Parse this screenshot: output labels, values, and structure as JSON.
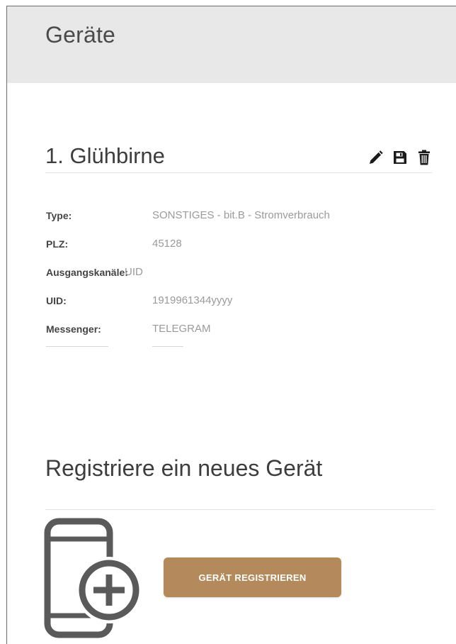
{
  "page": {
    "title": "Geräte"
  },
  "device": {
    "index_title": "1. Glühbirne",
    "actions": [
      {
        "name": "edit",
        "icon": "pencil-icon"
      },
      {
        "name": "save",
        "icon": "floppy-disk-icon"
      },
      {
        "name": "delete",
        "icon": "trash-icon"
      }
    ],
    "details": [
      {
        "label": "Type:",
        "value": "SONSTIGES - bit.B - Stromverbrauch"
      },
      {
        "label": "PLZ:",
        "value": "45128"
      },
      {
        "label": "Ausgangskanäle:",
        "value": "UID"
      },
      {
        "label": "UID:",
        "value": "1919961344yyyy"
      },
      {
        "label": "Messenger:",
        "value": "TELEGRAM"
      }
    ]
  },
  "register": {
    "heading": "Registriere ein neues Gerät",
    "icon": "phone-plus-icon",
    "button_label": "GERÄT REGISTRIEREN"
  },
  "colors": {
    "header_bg": "#e8e8e8",
    "button_bg": "#b48a5c",
    "icon_gray": "#5a5a5a"
  }
}
